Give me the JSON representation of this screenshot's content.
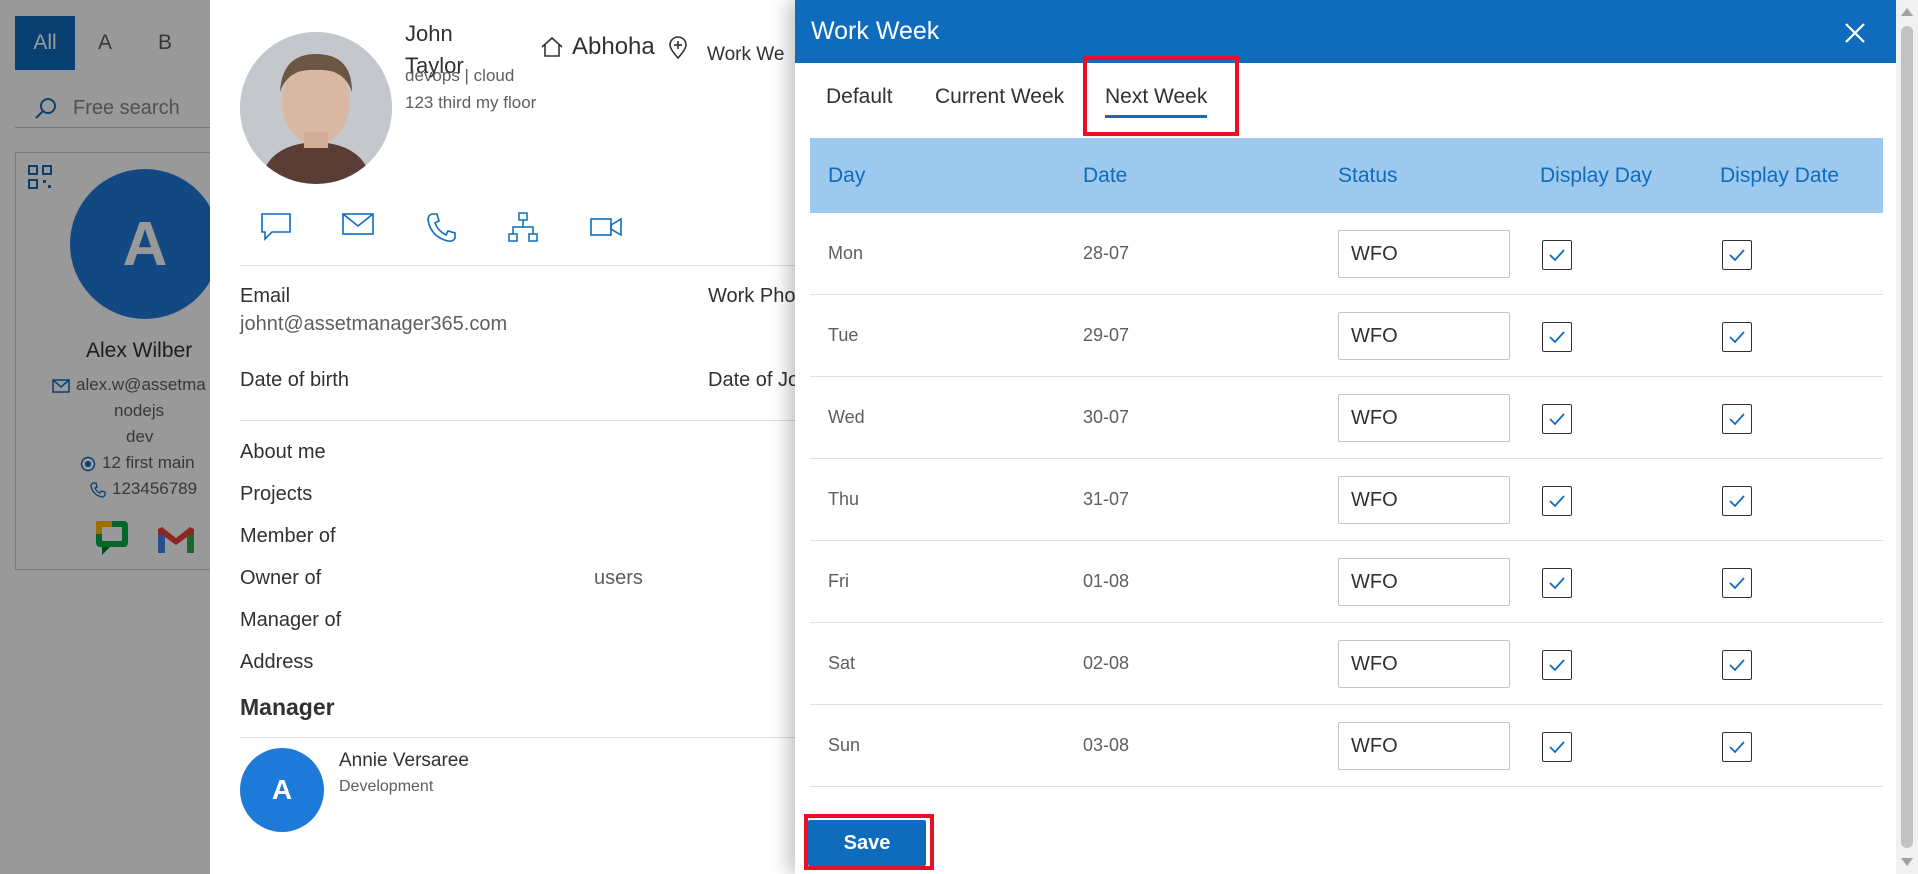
{
  "directory": {
    "alpha_filters": [
      "All",
      "A",
      "B"
    ],
    "search_placeholder": "Free search",
    "card": {
      "initial": "A",
      "name": "Alex Wilber",
      "email": "alex.w@assetma",
      "dept": "nodejs",
      "role": "dev",
      "address": "12 first main",
      "phone": "123456789"
    }
  },
  "profile": {
    "first_name": "John",
    "last_name": "Taylor",
    "dept_line": "devops | cloud",
    "address_line": "123 third my floor",
    "location": "Abhoha",
    "work_week_label": "Work We",
    "fields": {
      "email_label": "Email",
      "email_value": "johnt@assetmanager365.com",
      "work_phone_label": "Work Pho",
      "dob_label": "Date of birth",
      "doj_label": "Date of Jo",
      "about_label": "About me",
      "projects_label": "Projects",
      "member_label": "Member of",
      "owner_label": "Owner of",
      "owner_value": "users",
      "manager_of_label": "Manager of",
      "address_label": "Address"
    },
    "manager": {
      "title": "Manager",
      "initial": "A",
      "name": "Annie Versaree",
      "dept": "Development"
    }
  },
  "modal": {
    "title": "Work Week",
    "tabs": [
      "Default",
      "Current Week",
      "Next Week"
    ],
    "active_tab": "Next Week",
    "columns": [
      "Day",
      "Date",
      "Status",
      "Display Day",
      "Display Date"
    ],
    "rows": [
      {
        "day": "Mon",
        "date": "28-07",
        "status": "WFO",
        "display_day": true,
        "display_date": true
      },
      {
        "day": "Tue",
        "date": "29-07",
        "status": "WFO",
        "display_day": true,
        "display_date": true
      },
      {
        "day": "Wed",
        "date": "30-07",
        "status": "WFO",
        "display_day": true,
        "display_date": true
      },
      {
        "day": "Thu",
        "date": "31-07",
        "status": "WFO",
        "display_day": true,
        "display_date": true
      },
      {
        "day": "Fri",
        "date": "01-08",
        "status": "WFO",
        "display_day": true,
        "display_date": true
      },
      {
        "day": "Sat",
        "date": "02-08",
        "status": "WFO",
        "display_day": true,
        "display_date": true
      },
      {
        "day": "Sun",
        "date": "03-08",
        "status": "WFO",
        "display_day": true,
        "display_date": true
      }
    ],
    "save_label": "Save"
  },
  "colors": {
    "primary": "#0f6cbd",
    "header_row": "#9ec9ee",
    "highlight": "#e81123",
    "avatar": "#1e7ad9"
  }
}
